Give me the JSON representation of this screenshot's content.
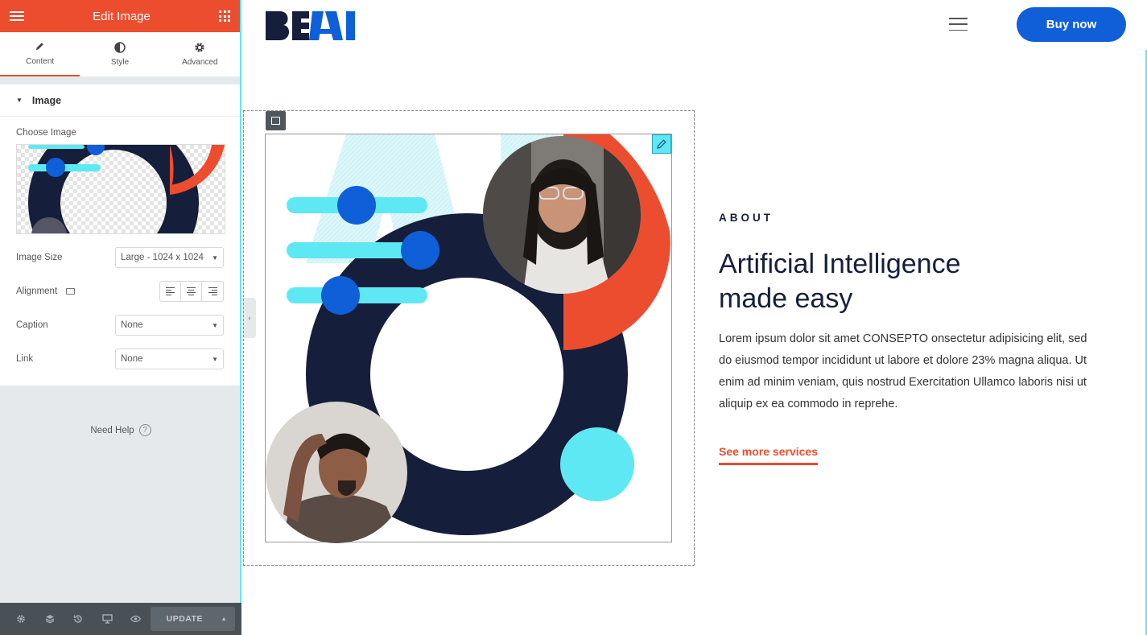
{
  "panel": {
    "title": "Edit Image",
    "tabs": [
      {
        "label": "Content",
        "icon": "pencil-icon",
        "active": true
      },
      {
        "label": "Style",
        "icon": "contrast-icon",
        "active": false
      },
      {
        "label": "Advanced",
        "icon": "gear-icon",
        "active": false
      }
    ],
    "section_title": "Image",
    "choose_image_label": "Choose Image",
    "image_size_label": "Image Size",
    "image_size_value": "Large - 1024 x 1024",
    "alignment_label": "Alignment",
    "caption_label": "Caption",
    "caption_value": "None",
    "link_label": "Link",
    "link_value": "None",
    "need_help": "Need Help",
    "update_label": "UPDATE"
  },
  "site": {
    "logo": "BEAI",
    "buy_button": "Buy now",
    "about_label": "ABOUT",
    "title_line1": "Artificial Intelligence",
    "title_line2": "made easy",
    "body_text": "Lorem ipsum dolor sit amet CONSEPTO onsectetur adipisicing elit, sed do eiusmod tempor incididunt ut labore et dolore 23% magna aliqua. Ut enim ad minim veniam, quis nostrud Exercitation Ullamco laboris nisi ut aliquip ex ea commodo in reprehe.",
    "link_text": "See more services"
  },
  "colors": {
    "accent_red": "#ec4d2f",
    "navy": "#151f3c",
    "blue": "#0f5fd8",
    "cyan": "#5ee8f4"
  }
}
